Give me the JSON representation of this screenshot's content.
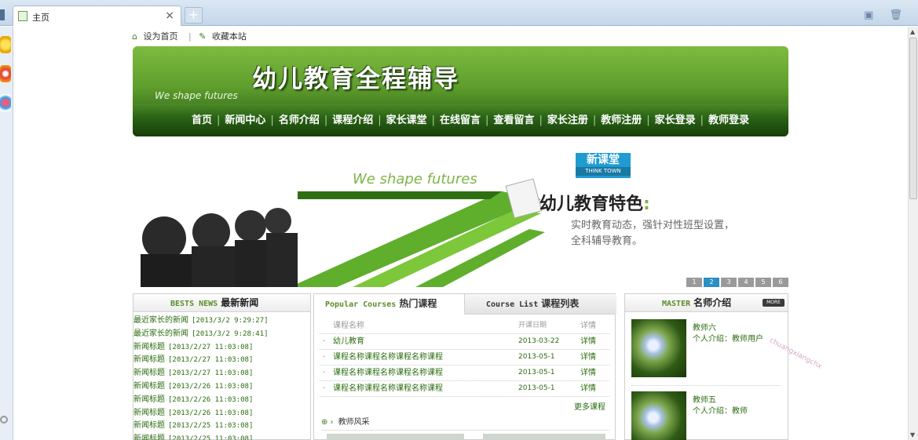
{
  "browser": {
    "tab_title": "主页",
    "tab_close": "×",
    "new_tab": "+",
    "tool_icons": "▣ 🗑"
  },
  "toplinks": {
    "home": "设为首页",
    "fav": "收藏本站"
  },
  "banner": {
    "title": "幼儿教育全程辅导",
    "slogan": "We shape futures",
    "nav": [
      "首页",
      "新闻中心",
      "名师介绍",
      "课程介绍",
      "家长课堂",
      "在线留言",
      "查看留言",
      "家长注册",
      "教师注册",
      "家长登录",
      "教师登录"
    ]
  },
  "flash": {
    "slogan": "We shape futures",
    "logo_cn": "新课堂",
    "logo_en": "THINK TOWN",
    "feature": "幼儿教育特色",
    "colon": ":",
    "desc1": "实时教育动态，强针对性班型设置，",
    "desc2": "全科辅导教育。",
    "pages": [
      "1",
      "2",
      "3",
      "4",
      "5",
      "6"
    ],
    "active_page": 2
  },
  "news": {
    "title_en": "BESTS NEWS",
    "title_cn": "最新新闻",
    "items": [
      {
        "title": "最近家长的新闻",
        "date": "[2013/3/2 9:29:27]"
      },
      {
        "title": "最近家长的新闻",
        "date": "[2013/3/2 9:28:41]"
      },
      {
        "title": "新闻标题",
        "date": "[2013/2/27 11:03:08]"
      },
      {
        "title": "新闻标题",
        "date": "[2013/2/27 11:03:08]"
      },
      {
        "title": "新闻标题",
        "date": "[2013/2/27 11:03:08]"
      },
      {
        "title": "新闻标题",
        "date": "[2013/2/26 11:03:08]"
      },
      {
        "title": "新闻标题",
        "date": "[2013/2/26 11:03:08]"
      },
      {
        "title": "新闻标题",
        "date": "[2013/2/26 11:03:08]"
      },
      {
        "title": "新闻标题",
        "date": "[2013/2/25 11:03:08]"
      },
      {
        "title": "新闻标题",
        "date": "[2013/2/25 11:03:08]"
      }
    ]
  },
  "courses": {
    "tab1_en": "Popular Courses",
    "tab1_cn": "热门课程",
    "tab2_en": "Course List",
    "tab2_cn": "课程列表",
    "headers": [
      "课程名称",
      "开课日期",
      "详情"
    ],
    "rows": [
      {
        "name": "幼儿教育",
        "date": "2013-03-22",
        "detail": "详情"
      },
      {
        "name": "课程名称课程名称课程名称课程",
        "date": "2013-05-1",
        "detail": "详情"
      },
      {
        "name": "课程名称课程名称课程名称课程",
        "date": "2013-05-1",
        "detail": "详情"
      },
      {
        "name": "课程名称课程名称课程名称课程",
        "date": "2013-05-1",
        "detail": "详情"
      }
    ],
    "more": "更多课程",
    "teacher_style": "教师风采"
  },
  "teachers": {
    "title_en": "MASTER",
    "title_cn": "名师介绍",
    "more": "MORE",
    "items": [
      {
        "name": "教师六",
        "desc": "个人介绍：教师用户"
      },
      {
        "name": "教师五",
        "desc": "个人介绍：教师"
      }
    ]
  },
  "watermark": "chuangxiangchx"
}
